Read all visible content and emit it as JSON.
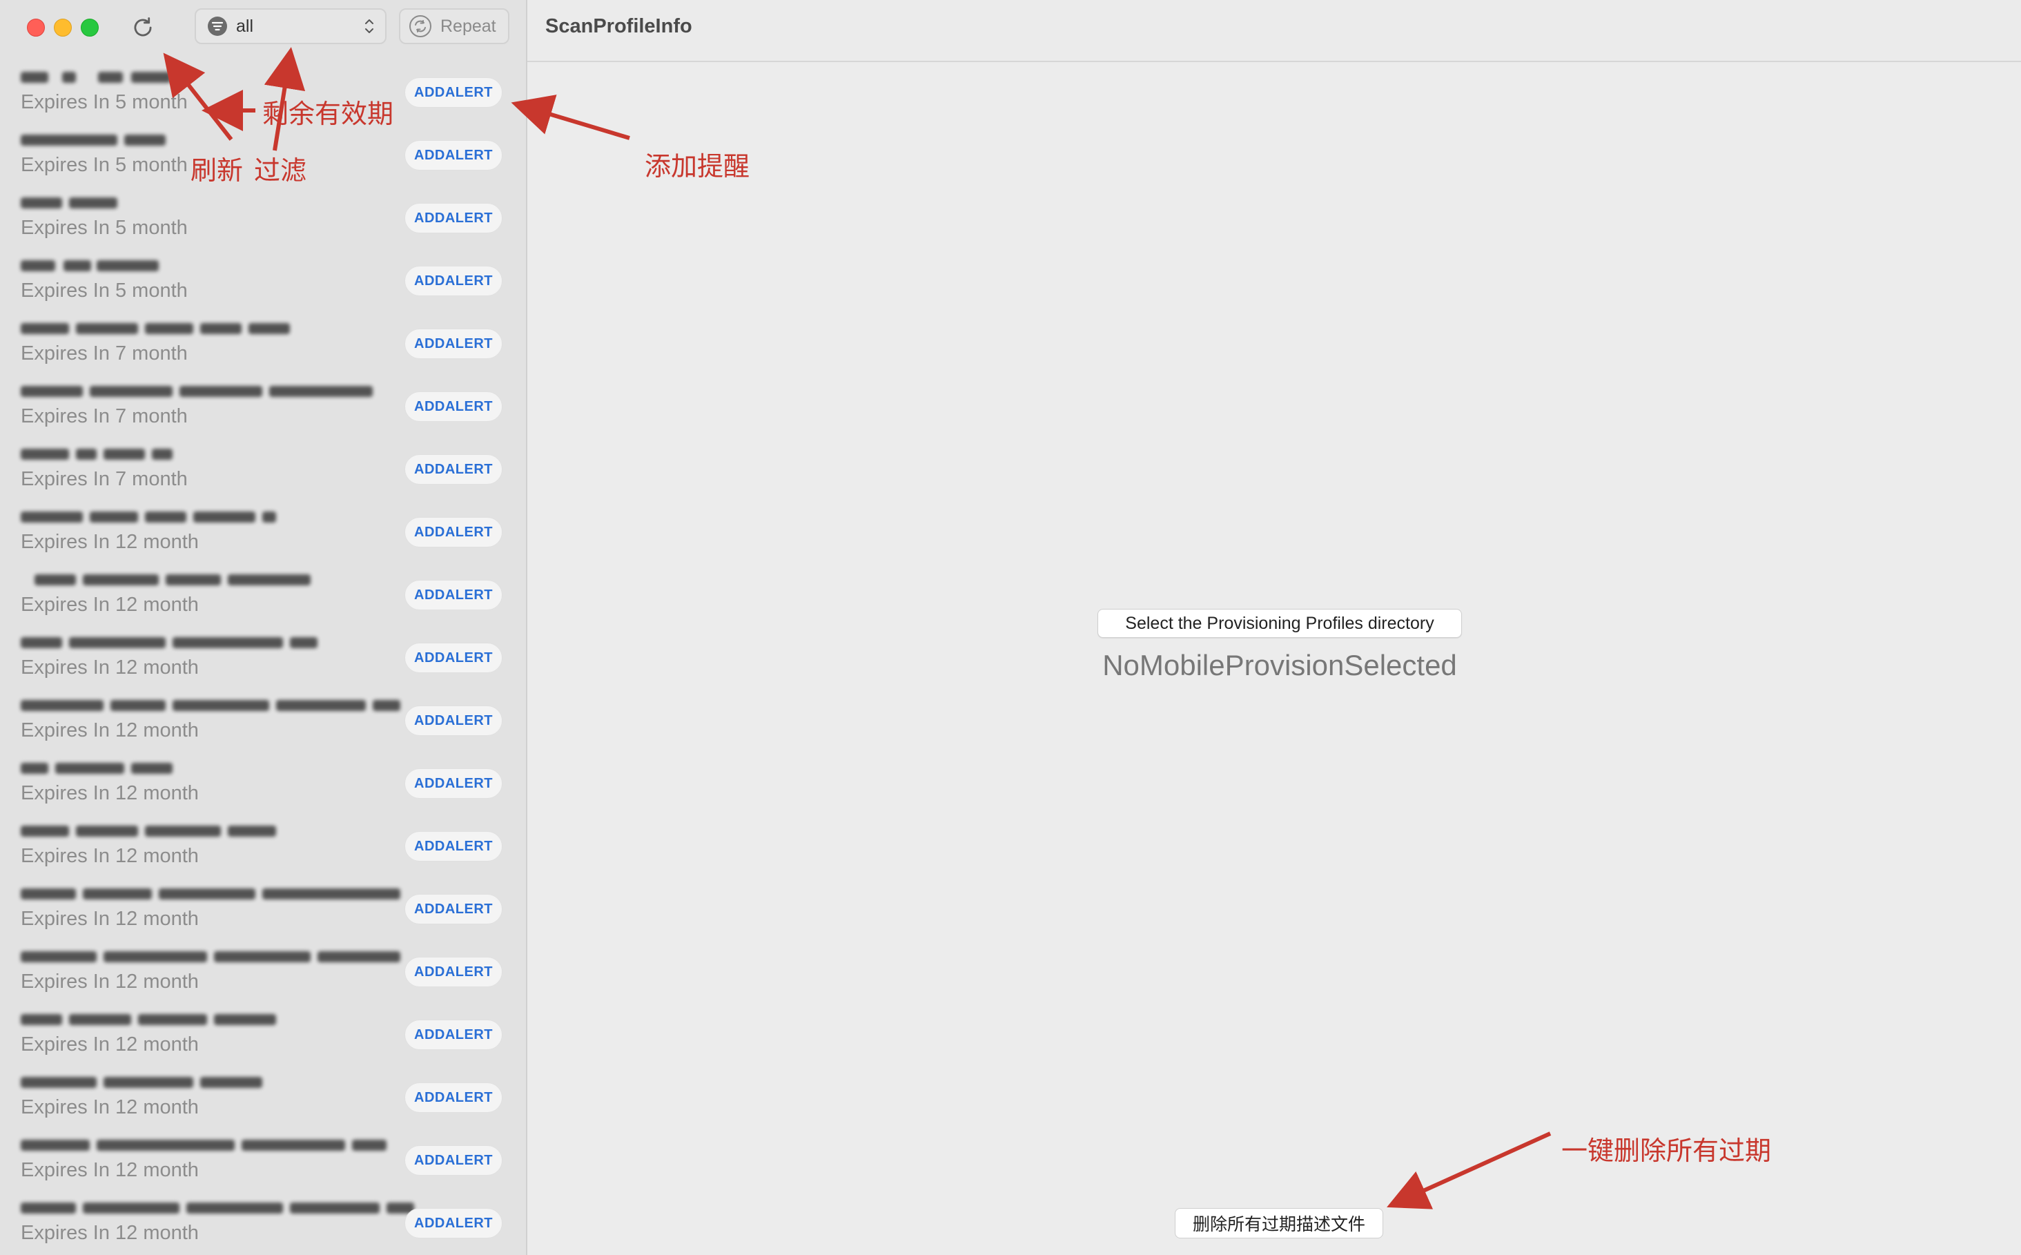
{
  "window": {
    "title": "ScanProfileInfo"
  },
  "toolbar": {
    "filter_value": "all",
    "repeat_label": "Repeat"
  },
  "icons": {
    "refresh": "refresh-icon",
    "filter": "filter-icon",
    "chevron": "chevron-updown-icon",
    "repeat": "repeat-icon"
  },
  "profiles": [
    {
      "expiry": "Expires In 5 month",
      "alert_label": "ADDALERT"
    },
    {
      "expiry": "Expires In 5 month",
      "alert_label": "ADDALERT"
    },
    {
      "expiry": "Expires In 5 month",
      "alert_label": "ADDALERT"
    },
    {
      "expiry": "Expires In 5 month",
      "alert_label": "ADDALERT"
    },
    {
      "expiry": "Expires In 7 month",
      "alert_label": "ADDALERT"
    },
    {
      "expiry": "Expires In 7 month",
      "alert_label": "ADDALERT"
    },
    {
      "expiry": "Expires In 7 month",
      "alert_label": "ADDALERT"
    },
    {
      "expiry": "Expires In 12 month",
      "alert_label": "ADDALERT"
    },
    {
      "expiry": "Expires In 12 month",
      "alert_label": "ADDALERT"
    },
    {
      "expiry": "Expires In 12 month",
      "alert_label": "ADDALERT"
    },
    {
      "expiry": "Expires In 12 month",
      "alert_label": "ADDALERT"
    },
    {
      "expiry": "Expires In 12 month",
      "alert_label": "ADDALERT"
    },
    {
      "expiry": "Expires In 12 month",
      "alert_label": "ADDALERT"
    },
    {
      "expiry": "Expires In 12 month",
      "alert_label": "ADDALERT"
    },
    {
      "expiry": "Expires In 12 month",
      "alert_label": "ADDALERT"
    },
    {
      "expiry": "Expires In 12 month",
      "alert_label": "ADDALERT"
    },
    {
      "expiry": "Expires In 12 month",
      "alert_label": "ADDALERT"
    },
    {
      "expiry": "Expires In 12 month",
      "alert_label": "ADDALERT"
    },
    {
      "expiry": "Expires In 12 month",
      "alert_label": "ADDALERT"
    }
  ],
  "main": {
    "select_dir_label": "Select the Provisioning Profiles directory",
    "empty_state": "NoMobileProvisionSelected",
    "delete_expired_label": "删除所有过期描述文件"
  },
  "annotations": {
    "remaining_validity": "剩余有效期",
    "refresh": "刷新",
    "filter": "过滤",
    "add_reminder": "添加提醒",
    "delete_all_expired": "一键删除所有过期"
  },
  "colors": {
    "accent": "#2a6fd6",
    "annotation": "#c8372d",
    "close": "#ff5f57",
    "minimize": "#febc2e",
    "zoom": "#28c840"
  }
}
